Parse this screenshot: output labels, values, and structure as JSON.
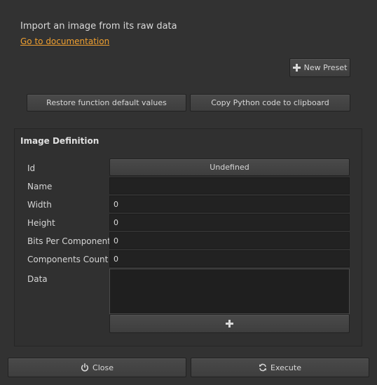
{
  "header": {
    "description": "Import an image from its raw data",
    "doc_link": "Go to documentation"
  },
  "toolbar": {
    "new_preset_label": "New Preset",
    "restore_label": "Restore function default values",
    "copy_label": "Copy Python code to clipboard"
  },
  "image_definition": {
    "title": "Image Definition",
    "fields": {
      "id": {
        "label": "Id",
        "value": "Undefined"
      },
      "name": {
        "label": "Name",
        "value": ""
      },
      "width": {
        "label": "Width",
        "value": "0"
      },
      "height": {
        "label": "Height",
        "value": "0"
      },
      "bits_per_component": {
        "label": "Bits Per Component",
        "value": "0"
      },
      "components_count": {
        "label": "Components Count",
        "value": "0"
      },
      "data": {
        "label": "Data"
      }
    }
  },
  "footer": {
    "close_label": "Close",
    "execute_label": "Execute"
  },
  "icons": {
    "plus": "plus-icon",
    "power": "power-icon",
    "refresh": "refresh-icon"
  },
  "colors": {
    "background": "#323232",
    "link": "#f0a030",
    "field_bg": "#222222"
  }
}
